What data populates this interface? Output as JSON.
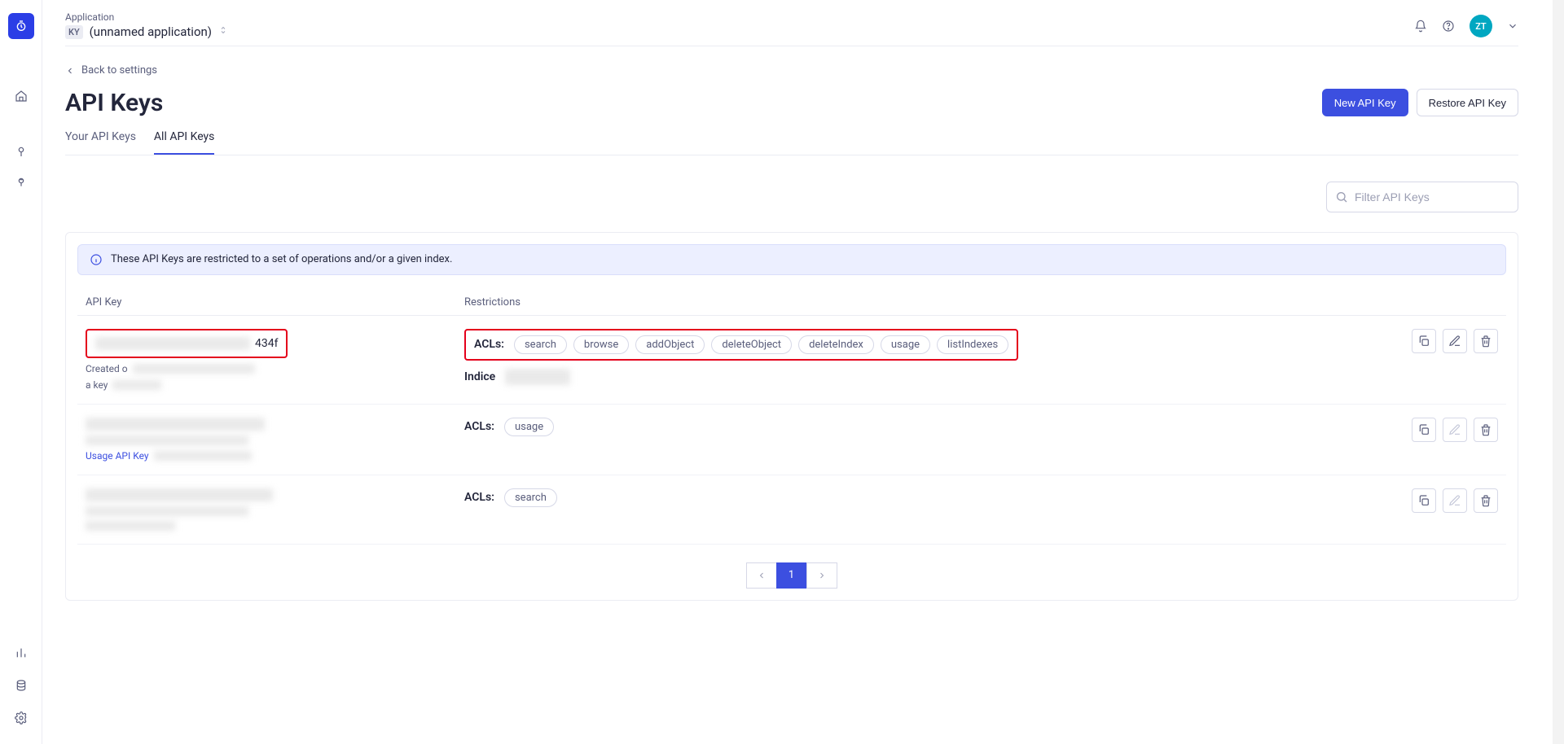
{
  "rail": {
    "brand": "stopwatch-icon",
    "items": [
      "home-icon",
      "pin-icon",
      "pin-add-icon",
      "chart-icon",
      "database-icon",
      "gear-icon"
    ]
  },
  "header": {
    "app_label": "Application",
    "app_badge": "KY",
    "app_name": "(unnamed application)",
    "avatar_initials": "ZT"
  },
  "page": {
    "back_label": "Back to settings",
    "title": "API Keys",
    "new_key_btn": "New API Key",
    "restore_btn": "Restore API Key",
    "tabs": [
      {
        "label": "Your API Keys",
        "active": false
      },
      {
        "label": "All API Keys",
        "active": true
      }
    ],
    "search_placeholder": "Filter API Keys",
    "info_banner": "These API Keys are restricted to a set of operations and/or a given index.",
    "columns": {
      "key": "API Key",
      "restrictions": "Restrictions"
    },
    "acls_label": "ACLs:",
    "indices_label": "Indice",
    "rows": [
      {
        "key_suffix": "434f",
        "meta1": "Created o",
        "meta2": "a key",
        "acls": [
          "search",
          "browse",
          "addObject",
          "deleteObject",
          "deleteIndex",
          "usage",
          "listIndexes"
        ],
        "has_indices": true,
        "highlighted": true,
        "edit_enabled": true
      },
      {
        "meta3": "Usage API Key",
        "acls": [
          "usage"
        ],
        "highlighted": false,
        "edit_enabled": false
      },
      {
        "acls": [
          "search"
        ],
        "highlighted": false,
        "edit_enabled": false
      }
    ],
    "pager": {
      "current": "1"
    }
  }
}
